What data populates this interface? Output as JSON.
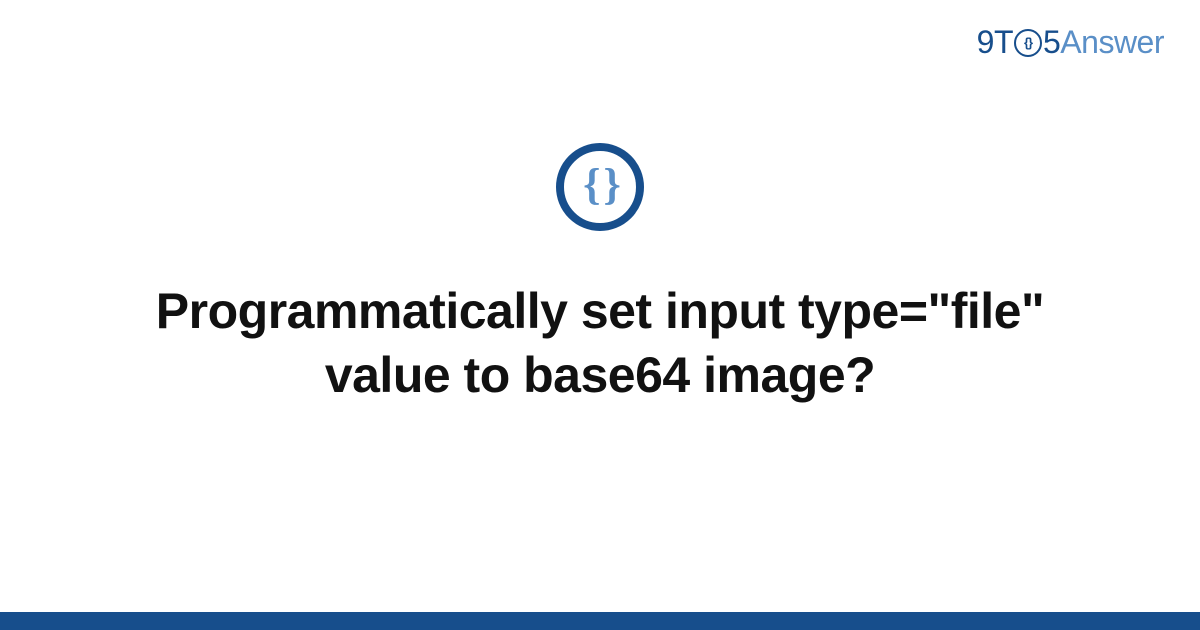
{
  "brand": {
    "part1": "9",
    "part2": "T",
    "circle": "{}",
    "part3": "5",
    "part4": "Answer"
  },
  "icon": {
    "glyph": "{ }",
    "name": "code-braces-icon"
  },
  "title": "Programmatically set input type=\"file\" value to base64 image?",
  "colors": {
    "primary": "#174e8c",
    "accent": "#5a8fc7",
    "text": "#111111",
    "background": "#ffffff"
  }
}
